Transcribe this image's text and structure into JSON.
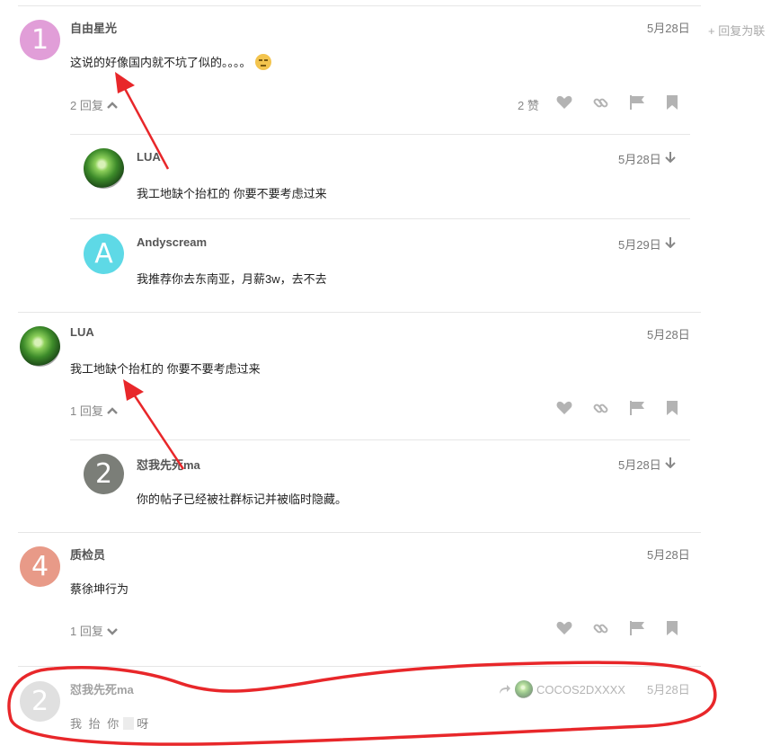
{
  "side": {
    "reply_as_linked": "回复为联"
  },
  "posts": [
    {
      "number": "1",
      "avatar_color": "#e19ed8",
      "user": "自由星光",
      "date": "5月28日",
      "text": "这说的好像国内就不坑了似的。。。。",
      "emoji": "unamused-face",
      "replies_label": "2 回复",
      "likes_label": "2 赞"
    },
    {
      "user": "LUA",
      "date": "5月28日",
      "text": "我工地缺个抬杠的 你要不要考虑过来",
      "replies_label": "1 回复"
    },
    {
      "number": "4",
      "avatar_color": "#e89a88",
      "user": "质检员",
      "date": "5月28日",
      "text": "蔡徐坤行为",
      "replies_label": "1 回复"
    },
    {
      "number": "2",
      "avatar_color": "#c8c8c8",
      "user": "怼我先死ma",
      "date": "5月28日",
      "text": "我 抬 你",
      "text_end": "呀",
      "reply_to": "COCOS2DXXXX"
    }
  ],
  "replies_post1": [
    {
      "user": "LUA",
      "date": "5月28日",
      "text": "我工地缺个抬杠的 你要不要考虑过来"
    },
    {
      "letter": "A",
      "avatar_color": "#5ed9e6",
      "user": "Andyscream",
      "date": "5月29日",
      "text": "我推荐你去东南亚，月薪3w，去不去"
    }
  ],
  "replies_post2": [
    {
      "number": "2",
      "avatar_color": "#7b7e78",
      "user": "怼我先死ma",
      "date": "5月28日",
      "text": "你的帖子已经被社群标记并被临时隐藏。"
    }
  ],
  "colors": {
    "annotation_red": "#e8272a",
    "icon_gray": "#b3b3b3"
  }
}
